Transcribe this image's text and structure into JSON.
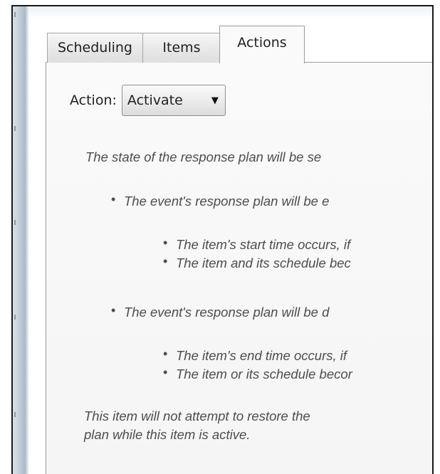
{
  "tabs": [
    {
      "label": "Scheduling",
      "active": false
    },
    {
      "label": "Items",
      "active": false
    },
    {
      "label": "Actions",
      "active": true
    }
  ],
  "action": {
    "label": "Action:",
    "selected": "Activate"
  },
  "description": {
    "intro": "The state of the response plan will be se",
    "enable_bullet": "The event's response plan will be e",
    "enable_sub": [
      "The item's start time occurs, if",
      "The item and its schedule bec"
    ],
    "disable_bullet": "The event's response plan will be d",
    "disable_sub": [
      "The item's end time occurs, if",
      "The item or its schedule becor"
    ],
    "note_line1": "This item will not attempt to restore the",
    "note_line2": "plan while this item is active."
  },
  "icons": {
    "dropdown": "caret-down-icon",
    "bullet": "bullet-dot"
  }
}
